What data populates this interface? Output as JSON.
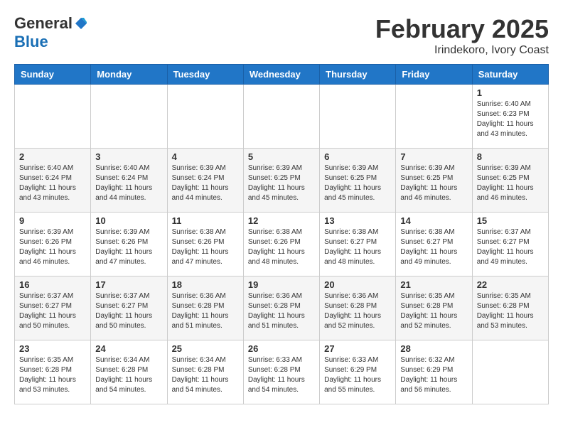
{
  "logo": {
    "general": "General",
    "blue": "Blue"
  },
  "header": {
    "month": "February 2025",
    "location": "Irindekoro, Ivory Coast"
  },
  "weekdays": [
    "Sunday",
    "Monday",
    "Tuesday",
    "Wednesday",
    "Thursday",
    "Friday",
    "Saturday"
  ],
  "weeks": [
    [
      {
        "day": "",
        "info": ""
      },
      {
        "day": "",
        "info": ""
      },
      {
        "day": "",
        "info": ""
      },
      {
        "day": "",
        "info": ""
      },
      {
        "day": "",
        "info": ""
      },
      {
        "day": "",
        "info": ""
      },
      {
        "day": "1",
        "info": "Sunrise: 6:40 AM\nSunset: 6:23 PM\nDaylight: 11 hours\nand 43 minutes."
      }
    ],
    [
      {
        "day": "2",
        "info": "Sunrise: 6:40 AM\nSunset: 6:24 PM\nDaylight: 11 hours\nand 43 minutes."
      },
      {
        "day": "3",
        "info": "Sunrise: 6:40 AM\nSunset: 6:24 PM\nDaylight: 11 hours\nand 44 minutes."
      },
      {
        "day": "4",
        "info": "Sunrise: 6:39 AM\nSunset: 6:24 PM\nDaylight: 11 hours\nand 44 minutes."
      },
      {
        "day": "5",
        "info": "Sunrise: 6:39 AM\nSunset: 6:25 PM\nDaylight: 11 hours\nand 45 minutes."
      },
      {
        "day": "6",
        "info": "Sunrise: 6:39 AM\nSunset: 6:25 PM\nDaylight: 11 hours\nand 45 minutes."
      },
      {
        "day": "7",
        "info": "Sunrise: 6:39 AM\nSunset: 6:25 PM\nDaylight: 11 hours\nand 46 minutes."
      },
      {
        "day": "8",
        "info": "Sunrise: 6:39 AM\nSunset: 6:25 PM\nDaylight: 11 hours\nand 46 minutes."
      }
    ],
    [
      {
        "day": "9",
        "info": "Sunrise: 6:39 AM\nSunset: 6:26 PM\nDaylight: 11 hours\nand 46 minutes."
      },
      {
        "day": "10",
        "info": "Sunrise: 6:39 AM\nSunset: 6:26 PM\nDaylight: 11 hours\nand 47 minutes."
      },
      {
        "day": "11",
        "info": "Sunrise: 6:38 AM\nSunset: 6:26 PM\nDaylight: 11 hours\nand 47 minutes."
      },
      {
        "day": "12",
        "info": "Sunrise: 6:38 AM\nSunset: 6:26 PM\nDaylight: 11 hours\nand 48 minutes."
      },
      {
        "day": "13",
        "info": "Sunrise: 6:38 AM\nSunset: 6:27 PM\nDaylight: 11 hours\nand 48 minutes."
      },
      {
        "day": "14",
        "info": "Sunrise: 6:38 AM\nSunset: 6:27 PM\nDaylight: 11 hours\nand 49 minutes."
      },
      {
        "day": "15",
        "info": "Sunrise: 6:37 AM\nSunset: 6:27 PM\nDaylight: 11 hours\nand 49 minutes."
      }
    ],
    [
      {
        "day": "16",
        "info": "Sunrise: 6:37 AM\nSunset: 6:27 PM\nDaylight: 11 hours\nand 50 minutes."
      },
      {
        "day": "17",
        "info": "Sunrise: 6:37 AM\nSunset: 6:27 PM\nDaylight: 11 hours\nand 50 minutes."
      },
      {
        "day": "18",
        "info": "Sunrise: 6:36 AM\nSunset: 6:28 PM\nDaylight: 11 hours\nand 51 minutes."
      },
      {
        "day": "19",
        "info": "Sunrise: 6:36 AM\nSunset: 6:28 PM\nDaylight: 11 hours\nand 51 minutes."
      },
      {
        "day": "20",
        "info": "Sunrise: 6:36 AM\nSunset: 6:28 PM\nDaylight: 11 hours\nand 52 minutes."
      },
      {
        "day": "21",
        "info": "Sunrise: 6:35 AM\nSunset: 6:28 PM\nDaylight: 11 hours\nand 52 minutes."
      },
      {
        "day": "22",
        "info": "Sunrise: 6:35 AM\nSunset: 6:28 PM\nDaylight: 11 hours\nand 53 minutes."
      }
    ],
    [
      {
        "day": "23",
        "info": "Sunrise: 6:35 AM\nSunset: 6:28 PM\nDaylight: 11 hours\nand 53 minutes."
      },
      {
        "day": "24",
        "info": "Sunrise: 6:34 AM\nSunset: 6:28 PM\nDaylight: 11 hours\nand 54 minutes."
      },
      {
        "day": "25",
        "info": "Sunrise: 6:34 AM\nSunset: 6:28 PM\nDaylight: 11 hours\nand 54 minutes."
      },
      {
        "day": "26",
        "info": "Sunrise: 6:33 AM\nSunset: 6:28 PM\nDaylight: 11 hours\nand 54 minutes."
      },
      {
        "day": "27",
        "info": "Sunrise: 6:33 AM\nSunset: 6:29 PM\nDaylight: 11 hours\nand 55 minutes."
      },
      {
        "day": "28",
        "info": "Sunrise: 6:32 AM\nSunset: 6:29 PM\nDaylight: 11 hours\nand 56 minutes."
      },
      {
        "day": "",
        "info": ""
      }
    ]
  ]
}
